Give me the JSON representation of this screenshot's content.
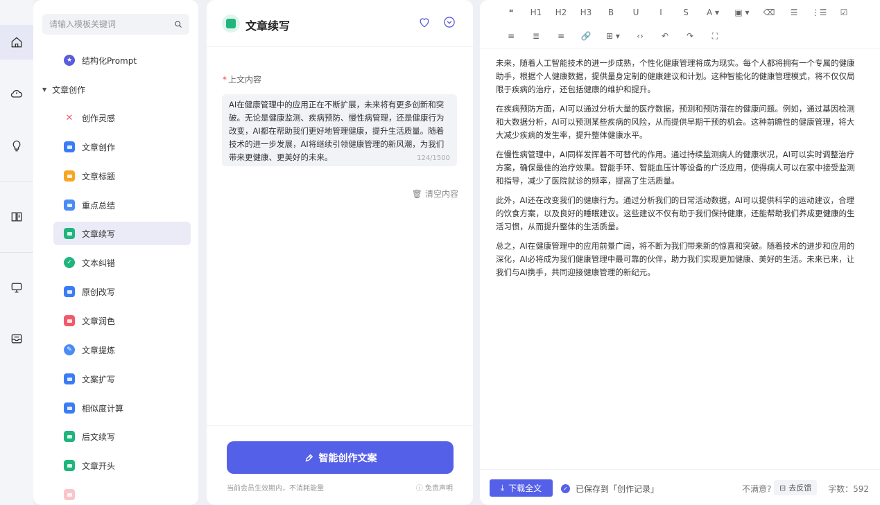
{
  "sidebar": {
    "search_placeholder": "请输入模板关键词",
    "top_item": {
      "label": "结构化Prompt",
      "icon": "star-icon",
      "color": "#5a5cdb"
    },
    "group_label": "文章创作",
    "items": [
      {
        "label": "创作灵感",
        "icon": "sparkle-icon",
        "color": "#f05a6a"
      },
      {
        "label": "文章创作",
        "icon": "doc-icon",
        "color": "#3b7cf5"
      },
      {
        "label": "文章标题",
        "icon": "title-icon",
        "color": "#f5a623"
      },
      {
        "label": "重点总结",
        "icon": "summary-icon",
        "color": "#4a8cf7"
      },
      {
        "label": "文章续写",
        "icon": "continue-icon",
        "color": "#1fb57d"
      },
      {
        "label": "文本纠错",
        "icon": "correct-icon",
        "color": "#1fb57d"
      },
      {
        "label": "原创改写",
        "icon": "rewrite-icon",
        "color": "#3b7cf5"
      },
      {
        "label": "文章润色",
        "icon": "polish-icon",
        "color": "#f05a6a"
      },
      {
        "label": "文章提炼",
        "icon": "refine-icon",
        "color": "#4a8cf7"
      },
      {
        "label": "文案扩写",
        "icon": "expand-icon",
        "color": "#3b7cf5"
      },
      {
        "label": "相似度计算",
        "icon": "similarity-icon",
        "color": "#3b7cf5"
      },
      {
        "label": "后文续写",
        "icon": "followup-icon",
        "color": "#1fb57d"
      },
      {
        "label": "文章开头",
        "icon": "opening-icon",
        "color": "#1fb57d"
      }
    ]
  },
  "middle": {
    "title": "文章续写",
    "field_label": "上文内容",
    "input_text": "AI在健康管理中的应用正在不断扩展，未来将有更多创新和突破。无论是健康监测、疾病预防、慢性病管理，还是健康行为改变，AI都在帮助我们更好地管理健康，提升生活质量。随着技术的进一步发展，AI将继续引领健康管理的新风潮，为我们带来更健康、更美好的未来。",
    "counter": "124/1500",
    "clear_label": "清空内容",
    "generate_label": "智能创作文案",
    "note": "当前会员生效期内，不消耗能量",
    "disclaimer": "免责声明"
  },
  "editor": {
    "toolbar_row1": [
      "❝",
      "H1",
      "H2",
      "H3",
      "B",
      "U",
      "I",
      "S",
      "A ▾",
      "▣ ▾",
      "⌫",
      "☰",
      "⋮☰",
      "☑"
    ],
    "toolbar_row2": [
      "≡",
      "≣",
      "≡",
      "🔗",
      "⊞ ▾",
      "‹›",
      "↶",
      "↷",
      "⛶"
    ],
    "paragraphs": [
      "未来，随着人工智能技术的进一步成熟，个性化健康管理将成为现实。每个人都将拥有一个专属的健康助手，根据个人健康数据，提供量身定制的健康建议和计划。这种智能化的健康管理模式，将不仅仅局限于疾病的治疗，还包括健康的维护和提升。",
      "在疾病预防方面，AI可以通过分析大量的医疗数据，预测和预防潜在的健康问题。例如，通过基因检测和大数据分析，AI可以预测某些疾病的风险，从而提供早期干预的机会。这种前瞻性的健康管理，将大大减少疾病的发生率，提升整体健康水平。",
      "在慢性病管理中，AI同样发挥着不可替代的作用。通过持续监测病人的健康状况，AI可以实时调整治疗方案，确保最佳的治疗效果。智能手环、智能血压计等设备的广泛应用，使得病人可以在家中接受监测和指导，减少了医院就诊的频率，提高了生活质量。",
      "此外，AI还在改变我们的健康行为。通过分析我们的日常活动数据，AI可以提供科学的运动建议，合理的饮食方案，以及良好的睡眠建议。这些建议不仅有助于我们保持健康，还能帮助我们养成更健康的生活习惯，从而提升整体的生活质量。",
      "总之，AI在健康管理中的应用前景广阔，将不断为我们带来新的惊喜和突破。随着技术的进步和应用的深化，AI必将成为我们健康管理中最可靠的伙伴，助力我们实现更加健康、美好的生活。未来已来，让我们与AI携手，共同迎接健康管理的新纪元。"
    ],
    "download_label": "下载全文",
    "saved_label": "已保存到「创作记录」",
    "unhappy_label": "不满意?",
    "feedback_label": "去反馈",
    "word_count": "字数：592"
  },
  "colors": {
    "accent": "#5560e8",
    "active_bg": "#ebebf8"
  }
}
